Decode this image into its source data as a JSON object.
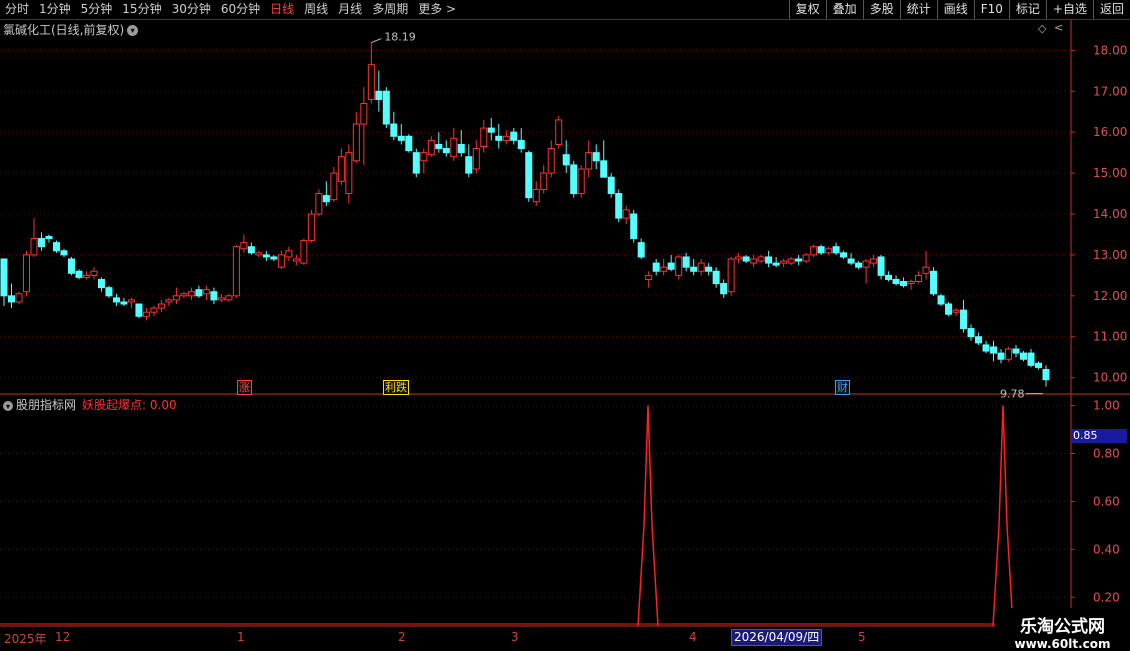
{
  "toolbar": {
    "periods": [
      "分时",
      "1分钟",
      "5分钟",
      "15分钟",
      "30分钟",
      "60分钟",
      "日线",
      "周线",
      "月线",
      "多周期",
      "更多 >"
    ],
    "active": "日线",
    "buttons": [
      "复权",
      "叠加",
      "多股",
      "统计",
      "画线",
      "F10",
      "标记",
      "+自选",
      "返回"
    ]
  },
  "chart": {
    "stock_title": "氯碱化工(日线,前复权)",
    "high_label": "18.19",
    "low_label": "9.78",
    "price_ticks": [
      "18.00",
      "17.00",
      "16.00",
      "15.00",
      "14.00",
      "13.00",
      "12.00",
      "11.00",
      "10.00"
    ],
    "markers": [
      {
        "text": "涨",
        "color": "#ff4040"
      },
      {
        "text": "利跌",
        "color": "#ffdd00"
      },
      {
        "text": "财",
        "color": "#40a0ff"
      }
    ]
  },
  "indicator": {
    "site": "股朋指标网",
    "name": "妖股起爆点: 0.00",
    "ticks": [
      "1.00",
      "0.80",
      "0.60",
      "0.40",
      "0.20"
    ],
    "current": "0.85"
  },
  "date_axis": {
    "labels": [
      "2025年",
      "12",
      "1",
      "2",
      "3",
      "4",
      "5"
    ],
    "current_date": "2026/04/09/四"
  },
  "watermark": {
    "line1": "乐淘公式网",
    "line2": "www.60lt.com"
  },
  "colors": {
    "up": "#ff3232",
    "down": "#54ffff",
    "grid": "#6a0000",
    "axis": "#c03030"
  },
  "chart_data": {
    "type": "candlestick",
    "title": "氯碱化工(日线,前复权)",
    "ylim": [
      9.6,
      18.4
    ],
    "high": 18.19,
    "low": 9.78,
    "ohlc": [
      [
        12.9,
        12.9,
        11.75,
        12.0
      ],
      [
        12.0,
        12.3,
        11.7,
        11.85
      ],
      [
        11.85,
        12.1,
        11.8,
        12.05
      ],
      [
        12.1,
        13.1,
        12.0,
        13.0
      ],
      [
        13.0,
        13.9,
        12.95,
        13.4
      ],
      [
        13.4,
        13.55,
        13.1,
        13.2
      ],
      [
        13.45,
        13.5,
        13.3,
        13.4
      ],
      [
        13.3,
        13.35,
        13.05,
        13.1
      ],
      [
        13.1,
        13.15,
        12.95,
        13.0
      ],
      [
        12.9,
        12.95,
        12.5,
        12.55
      ],
      [
        12.6,
        12.65,
        12.4,
        12.45
      ],
      [
        12.45,
        12.6,
        12.4,
        12.5
      ],
      [
        12.5,
        12.7,
        12.4,
        12.6
      ],
      [
        12.4,
        12.45,
        12.1,
        12.2
      ],
      [
        12.2,
        12.25,
        11.95,
        12.0
      ],
      [
        11.95,
        12.05,
        11.75,
        11.85
      ],
      [
        11.85,
        11.95,
        11.75,
        11.8
      ],
      [
        11.85,
        11.95,
        11.7,
        11.9
      ],
      [
        11.8,
        11.8,
        11.45,
        11.5
      ],
      [
        11.5,
        11.7,
        11.4,
        11.6
      ],
      [
        11.6,
        11.75,
        11.5,
        11.7
      ],
      [
        11.7,
        11.9,
        11.6,
        11.8
      ],
      [
        11.85,
        11.95,
        11.75,
        11.9
      ],
      [
        11.9,
        12.2,
        11.8,
        12.0
      ],
      [
        12.0,
        12.1,
        11.95,
        12.05
      ],
      [
        12.0,
        12.2,
        11.9,
        12.1
      ],
      [
        12.15,
        12.25,
        11.95,
        12.0
      ],
      [
        12.05,
        12.25,
        11.9,
        12.15
      ],
      [
        12.1,
        12.2,
        11.8,
        11.9
      ],
      [
        11.9,
        12.05,
        11.85,
        11.95
      ],
      [
        11.9,
        12.05,
        11.85,
        12.0
      ],
      [
        12.0,
        13.25,
        11.95,
        13.2
      ],
      [
        13.15,
        13.5,
        13.05,
        13.3
      ],
      [
        13.2,
        13.3,
        13.0,
        13.05
      ],
      [
        13.0,
        13.1,
        12.95,
        13.05
      ],
      [
        13.0,
        13.1,
        12.85,
        12.95
      ],
      [
        12.95,
        13.0,
        12.85,
        12.9
      ],
      [
        12.7,
        13.1,
        12.65,
        13.0
      ],
      [
        12.95,
        13.2,
        12.85,
        13.1
      ],
      [
        12.85,
        13.0,
        12.75,
        12.9
      ],
      [
        12.8,
        13.4,
        12.75,
        13.35
      ],
      [
        13.35,
        14.1,
        13.3,
        14.0
      ],
      [
        14.0,
        14.6,
        13.95,
        14.5
      ],
      [
        14.45,
        14.8,
        14.2,
        14.3
      ],
      [
        14.35,
        15.15,
        14.3,
        15.0
      ],
      [
        14.8,
        15.6,
        14.7,
        15.4
      ],
      [
        14.5,
        15.7,
        14.25,
        15.5
      ],
      [
        15.3,
        16.5,
        15.25,
        16.2
      ],
      [
        16.2,
        17.1,
        15.2,
        16.7
      ],
      [
        16.8,
        18.19,
        16.7,
        17.65
      ],
      [
        17.0,
        17.5,
        16.5,
        16.8
      ],
      [
        17.0,
        17.1,
        16.1,
        16.2
      ],
      [
        16.2,
        16.5,
        15.8,
        15.9
      ],
      [
        15.9,
        16.2,
        15.7,
        15.8
      ],
      [
        15.9,
        15.95,
        15.5,
        15.55
      ],
      [
        15.5,
        15.6,
        14.9,
        15.0
      ],
      [
        15.3,
        15.6,
        15.0,
        15.5
      ],
      [
        15.45,
        15.9,
        15.4,
        15.8
      ],
      [
        15.7,
        16.0,
        15.5,
        15.6
      ],
      [
        15.6,
        15.8,
        15.4,
        15.5
      ],
      [
        15.4,
        16.1,
        15.3,
        15.85
      ],
      [
        15.7,
        16.05,
        15.4,
        15.5
      ],
      [
        15.4,
        15.7,
        14.9,
        15.0
      ],
      [
        15.1,
        15.8,
        15.0,
        15.6
      ],
      [
        15.65,
        16.3,
        15.5,
        16.1
      ],
      [
        16.1,
        16.35,
        15.8,
        16.0
      ],
      [
        15.9,
        16.2,
        15.6,
        15.8
      ],
      [
        15.8,
        16.05,
        15.7,
        15.9
      ],
      [
        16.0,
        16.1,
        15.7,
        15.8
      ],
      [
        15.8,
        16.1,
        15.5,
        15.6
      ],
      [
        15.5,
        15.55,
        14.3,
        14.4
      ],
      [
        14.3,
        14.8,
        14.2,
        14.6
      ],
      [
        14.6,
        15.2,
        14.5,
        15.0
      ],
      [
        15.0,
        15.8,
        14.9,
        15.6
      ],
      [
        15.7,
        16.4,
        15.6,
        16.3
      ],
      [
        15.45,
        15.8,
        15.0,
        15.2
      ],
      [
        15.2,
        15.3,
        14.4,
        14.5
      ],
      [
        14.5,
        15.2,
        14.4,
        15.1
      ],
      [
        15.1,
        15.8,
        14.9,
        15.5
      ],
      [
        15.5,
        15.7,
        15.1,
        15.3
      ],
      [
        15.3,
        15.8,
        14.9,
        14.9
      ],
      [
        14.9,
        15.0,
        14.4,
        14.5
      ],
      [
        14.5,
        14.6,
        13.8,
        13.9
      ],
      [
        13.9,
        14.2,
        13.75,
        14.1
      ],
      [
        14.0,
        14.1,
        13.3,
        13.4
      ],
      [
        13.3,
        13.4,
        12.9,
        12.95
      ],
      [
        12.4,
        12.6,
        12.2,
        12.5
      ],
      [
        12.8,
        12.9,
        12.5,
        12.6
      ],
      [
        12.6,
        12.9,
        12.5,
        12.7
      ],
      [
        12.8,
        13.0,
        12.6,
        12.65
      ],
      [
        12.5,
        13.0,
        12.4,
        12.95
      ],
      [
        12.95,
        13.05,
        12.6,
        12.7
      ],
      [
        12.7,
        12.9,
        12.5,
        12.6
      ],
      [
        12.6,
        12.9,
        12.5,
        12.8
      ],
      [
        12.7,
        12.8,
        12.5,
        12.6
      ],
      [
        12.6,
        12.7,
        12.2,
        12.3
      ],
      [
        12.3,
        12.4,
        11.95,
        12.05
      ],
      [
        12.1,
        12.95,
        12.0,
        12.9
      ],
      [
        12.9,
        13.05,
        12.8,
        12.95
      ],
      [
        12.95,
        13.0,
        12.8,
        12.85
      ],
      [
        12.8,
        13.0,
        12.7,
        12.9
      ],
      [
        12.85,
        13.0,
        12.8,
        12.95
      ],
      [
        12.95,
        13.1,
        12.7,
        12.8
      ],
      [
        12.8,
        12.95,
        12.7,
        12.75
      ],
      [
        12.8,
        12.9,
        12.7,
        12.85
      ],
      [
        12.8,
        12.95,
        12.75,
        12.9
      ],
      [
        12.9,
        13.0,
        12.75,
        12.85
      ],
      [
        12.85,
        13.05,
        12.8,
        13.0
      ],
      [
        13.0,
        13.25,
        12.95,
        13.2
      ],
      [
        13.2,
        13.25,
        13.0,
        13.05
      ],
      [
        13.05,
        13.2,
        13.0,
        13.15
      ],
      [
        13.2,
        13.3,
        13.0,
        13.05
      ],
      [
        13.05,
        13.1,
        12.9,
        12.95
      ],
      [
        12.9,
        13.05,
        12.75,
        12.8
      ],
      [
        12.8,
        12.85,
        12.65,
        12.7
      ],
      [
        12.7,
        12.9,
        12.3,
        12.85
      ],
      [
        12.8,
        13.0,
        12.7,
        12.9
      ],
      [
        12.95,
        13.0,
        12.4,
        12.5
      ],
      [
        12.5,
        12.6,
        12.35,
        12.4
      ],
      [
        12.4,
        12.5,
        12.25,
        12.3
      ],
      [
        12.35,
        12.45,
        12.2,
        12.25
      ],
      [
        12.3,
        12.4,
        12.15,
        12.35
      ],
      [
        12.35,
        12.6,
        12.3,
        12.5
      ],
      [
        12.55,
        13.1,
        12.4,
        12.7
      ],
      [
        12.6,
        12.7,
        12.0,
        12.05
      ],
      [
        12.0,
        12.05,
        11.75,
        11.8
      ],
      [
        11.8,
        11.85,
        11.5,
        11.55
      ],
      [
        11.6,
        11.7,
        11.5,
        11.65
      ],
      [
        11.65,
        11.9,
        11.1,
        11.2
      ],
      [
        11.2,
        11.3,
        10.9,
        11.0
      ],
      [
        11.0,
        11.1,
        10.8,
        10.85
      ],
      [
        10.8,
        10.9,
        10.6,
        10.65
      ],
      [
        10.75,
        10.9,
        10.4,
        10.6
      ],
      [
        10.6,
        10.7,
        10.35,
        10.45
      ],
      [
        10.45,
        10.75,
        10.4,
        10.7
      ],
      [
        10.7,
        10.8,
        10.5,
        10.6
      ],
      [
        10.6,
        10.65,
        10.4,
        10.45
      ],
      [
        10.6,
        10.7,
        10.25,
        10.3
      ],
      [
        10.35,
        10.4,
        10.2,
        10.25
      ],
      [
        10.2,
        10.3,
        9.78,
        9.95
      ]
    ],
    "indicator_signals": [
      0,
      0,
      0,
      0,
      0,
      0,
      0,
      0,
      0,
      0,
      0,
      0,
      0,
      0,
      0,
      0,
      0,
      0,
      0,
      0,
      0,
      0,
      0,
      0,
      0,
      0,
      0,
      0,
      0,
      0,
      0,
      0,
      0,
      0,
      0,
      0,
      0,
      0,
      0,
      0,
      0,
      0,
      0,
      0,
      0,
      0,
      0,
      0,
      0,
      0,
      0,
      0,
      0,
      0,
      0,
      0,
      0,
      0,
      0,
      0,
      0,
      0,
      0,
      0,
      0,
      0,
      0,
      0,
      0,
      0,
      0,
      0,
      0,
      0,
      0,
      0,
      0,
      0,
      0,
      0,
      0,
      0,
      0,
      0,
      0,
      0,
      0,
      0,
      0,
      0,
      0,
      0,
      0,
      0,
      0,
      0,
      0,
      0,
      0,
      0,
      0,
      0,
      0,
      0,
      0,
      0,
      0,
      0,
      0,
      0,
      0,
      0,
      0,
      0,
      0,
      0,
      0,
      0,
      0,
      0,
      0,
      0,
      0,
      0,
      0,
      0,
      0,
      0,
      0,
      0,
      0,
      0,
      0,
      0,
      0,
      0,
      0,
      0,
      0,
      0,
      0,
      0,
      0
    ],
    "indicator_peaks_date_index": [
      2,
      6
    ]
  }
}
